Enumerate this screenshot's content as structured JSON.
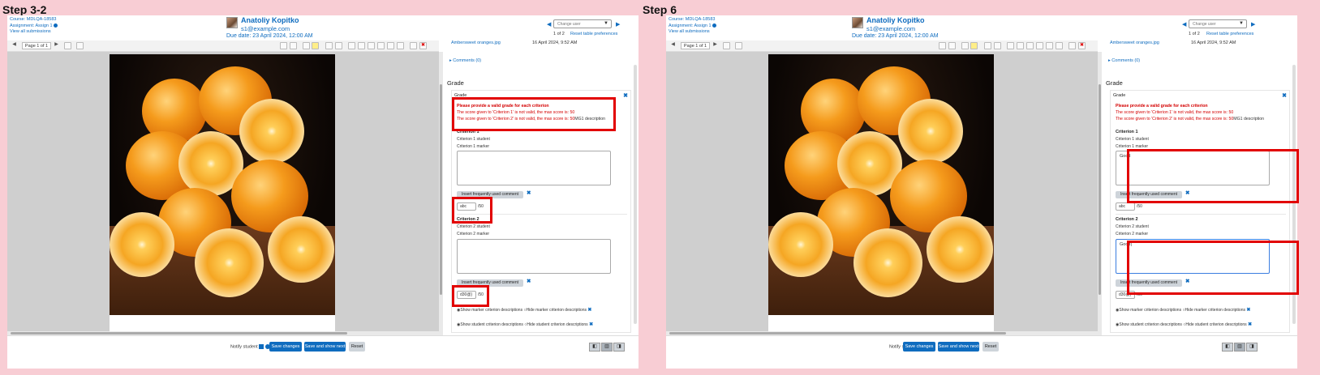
{
  "steps": [
    {
      "title": "Step 3-2",
      "header": {
        "course": "Course: MDLQA-18583",
        "assignment": "Assignment: Assign 1",
        "view_all": "View all submissions",
        "user_name": "Anatoliy Kopitko",
        "user_email": "s1@example.com",
        "due_date": "Due date: 23 April 2024, 12:00 AM",
        "change_user_placeholder": "Change user",
        "pager": "1 of 2",
        "reset_prefs": "Reset table preferences"
      },
      "toolbar": {
        "page_label": "Page 1 of 1"
      },
      "files": {
        "name": "Ambersweet oranges.jpg",
        "date": "16 April 2024, 9:52 AM",
        "comments": "Comments (0)"
      },
      "grade": {
        "heading": "Grade",
        "box_title": "Grade",
        "errors": {
          "title": "Please provide a valid grade for each criterion",
          "line1": "The score given to 'Criterion 1' is not valid, the max score is: 50",
          "line2": "The score given to 'Criterion 2' is not valid, the max score is: 50",
          "line2_tail": "MG1 description"
        },
        "criteria": [
          {
            "name": "Criterion 1",
            "student": "Criterion 1 student",
            "marker": "Criterion 1 marker",
            "marker_value": "",
            "freq": "Insert frequently used comment",
            "score": "abc",
            "max": "/50"
          },
          {
            "name": "Criterion 2",
            "student": "Criterion 2 student",
            "marker": "Criterion 2 marker",
            "marker_value": "",
            "freq": "Insert frequently used comment",
            "score": "d30@}",
            "max": "/50"
          }
        ],
        "show_marker": "Show marker criterion descriptions",
        "hide_marker": "Hide marker criterion descriptions",
        "show_student": "Show student criterion descriptions",
        "hide_student": "Hide student criterion descriptions"
      },
      "footer": {
        "notify": "Notify student",
        "save": "Save changes",
        "save_next": "Save and show next",
        "reset": "Reset"
      }
    },
    {
      "title": "Step 6",
      "header": {
        "course": "Course: MDLQA-18583",
        "assignment": "Assignment: Assign 1",
        "view_all": "View all submissions",
        "user_name": "Anatoliy Kopitko",
        "user_email": "s1@example.com",
        "due_date": "Due date: 23 April 2024, 12:00 AM",
        "change_user_placeholder": "Change user",
        "pager": "1 of 2",
        "reset_prefs": "Reset table preferences"
      },
      "toolbar": {
        "page_label": "Page 1 of 1"
      },
      "files": {
        "name": "Ambersweet oranges.jpg",
        "date": "16 April 2024, 9:52 AM",
        "comments": "Comments (0)"
      },
      "grade": {
        "heading": "Grade",
        "box_title": "Grade",
        "errors": {
          "title": "Please provide a valid grade for each criterion",
          "line1": "The score given to 'Criterion 1' is not valid, the max score is: 50",
          "line2": "The score given to 'Criterion 2' is not valid, the max score is: 50",
          "line2_tail": "MG1 description"
        },
        "criteria": [
          {
            "name": "Criterion 1",
            "student": "Criterion 1 student",
            "marker": "Criterion 1 marker",
            "marker_value": "Good",
            "freq": "Insert frequently used comment",
            "score": "abc",
            "max": "/50"
          },
          {
            "name": "Criterion 2",
            "student": "Criterion 2 student",
            "marker": "Criterion 2 marker",
            "marker_value": "Good|",
            "freq": "Insert frequently used comment",
            "score": "d30@}",
            "max": "/50"
          }
        ],
        "show_marker": "Show marker criterion descriptions",
        "hide_marker": "Hide marker criterion descriptions",
        "show_student": "Show student criterion descriptions",
        "hide_student": "Hide student criterion descriptions"
      },
      "footer": {
        "notify": "Notify student",
        "save": "Save changes",
        "save_next": "Save and show next",
        "reset": "Reset"
      }
    }
  ],
  "icons": {
    "prev": "◀",
    "next": "▶",
    "close": "✖",
    "caret": "▼"
  },
  "colors": {
    "link": "#0f6cbf",
    "error": "#d40000",
    "highlight": "#e20000",
    "background": "#f8cdd4"
  }
}
